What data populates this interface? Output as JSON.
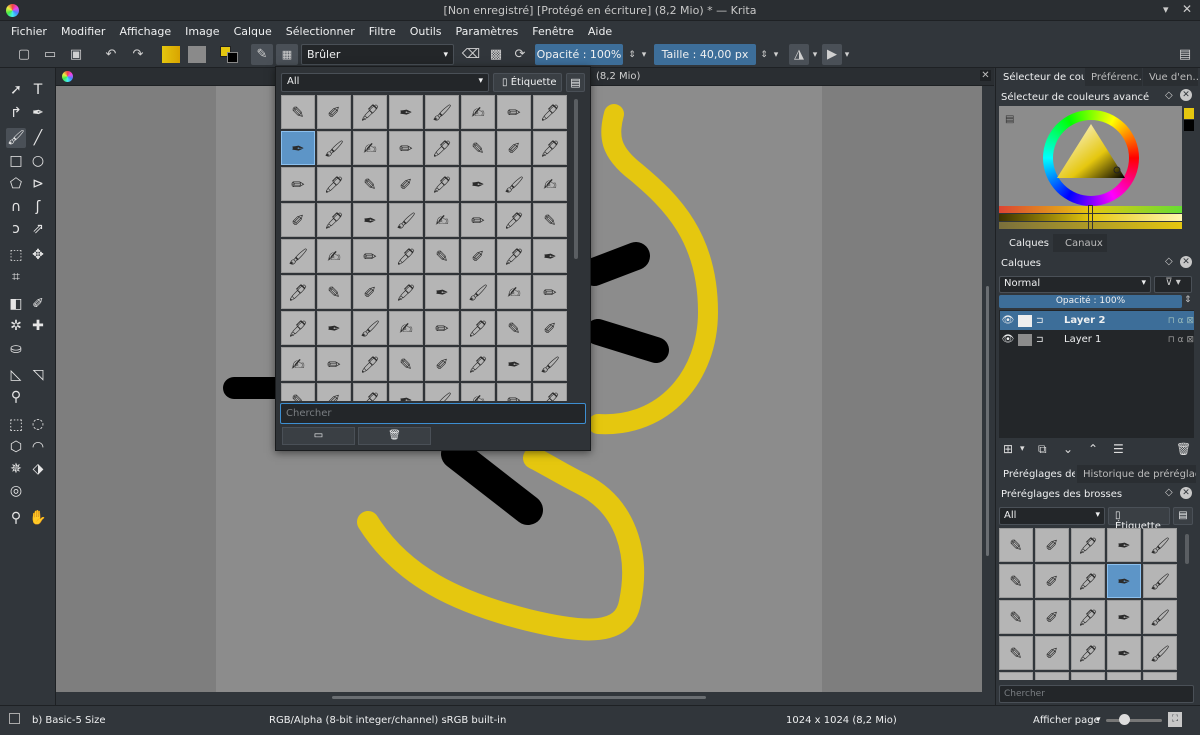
{
  "window": {
    "title": "[Non enregistré] [Protégé en écriture] (8,2 Mio) * — Krita"
  },
  "menu": [
    "Fichier",
    "Modifier",
    "Affichage",
    "Image",
    "Calque",
    "Sélectionner",
    "Filtre",
    "Outils",
    "Paramètres",
    "Fenêtre",
    "Aide"
  ],
  "toolbar": {
    "blend_mode": "Brûler",
    "opacity_label": "Opacité : 100%",
    "size_label": "Taille : 40,00 px"
  },
  "document": {
    "tab_label": "(8,2 Mio)"
  },
  "brush_popup": {
    "tag_filter": "All",
    "tag_button": "Étiquette",
    "search_placeholder": "Chercher"
  },
  "right_panel": {
    "top_tabs": [
      "Sélecteur de coul…",
      "Préférenc…",
      "Vue d'en…"
    ],
    "color_selector_title": "Sélecteur de couleurs avancé",
    "layer_tabs": [
      "Calques",
      "Canaux"
    ],
    "layers_title": "Calques",
    "blend_mode": "Normal",
    "opacity": "Opacité : 100%",
    "layers": [
      {
        "name": "Layer 2",
        "selected": true
      },
      {
        "name": "Layer 1",
        "selected": false
      }
    ],
    "preset_tabs": [
      "Préréglages de…",
      "Historique de préréglage …"
    ],
    "presets_title": "Préréglages des brosses",
    "preset_filter": "All",
    "preset_tag_button": "Étiquette",
    "preset_search": "Chercher"
  },
  "status": {
    "brush": "b) Basic-5 Size",
    "color_space": "RGB/Alpha (8-bit integer/channel)  sRGB built-in",
    "dimensions": "1024 x 1024 (8,2 Mio)",
    "zoom": "Afficher page"
  },
  "colors": {
    "accent": "#3d6e99",
    "stroke_yellow": "#e5c70f",
    "stroke_black": "#000000"
  }
}
